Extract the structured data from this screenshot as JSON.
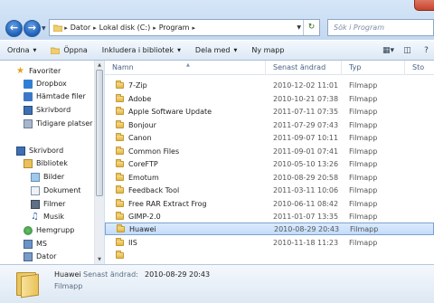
{
  "address": {
    "crumbs": [
      "Dator",
      "Lokal disk (C:)",
      "Program"
    ],
    "search_placeholder": "Sök i Program"
  },
  "toolbar": {
    "organize": "Ordna",
    "open": "Öppna",
    "include": "Inkludera i bibliotek",
    "share": "Dela med",
    "new_folder": "Ny mapp"
  },
  "nav": {
    "favorites": "Favoriter",
    "dropbox": "Dropbox",
    "downloads": "Hämtade filer",
    "desktop_fav": "Skrivbord",
    "recent": "Tidigare platser",
    "desktop": "Skrivbord",
    "libraries": "Bibliotek",
    "pictures": "Bilder",
    "documents": "Dokument",
    "videos": "Filmer",
    "music": "Musik",
    "homegroup": "Hemgrupp",
    "ms": "MS",
    "computer": "Dator"
  },
  "columns": {
    "name": "Namn",
    "date": "Senast ändrad",
    "type": "Typ",
    "size": "Sto"
  },
  "files": [
    {
      "name": "7-Zip",
      "date": "2010-12-02 11:01",
      "type": "Filmapp"
    },
    {
      "name": "Adobe",
      "date": "2010-10-21 07:38",
      "type": "Filmapp"
    },
    {
      "name": "Apple Software Update",
      "date": "2011-07-11 07:35",
      "type": "Filmapp"
    },
    {
      "name": "Bonjour",
      "date": "2011-07-29 07:43",
      "type": "Filmapp"
    },
    {
      "name": "Canon",
      "date": "2011-09-07 10:11",
      "type": "Filmapp"
    },
    {
      "name": "Common Files",
      "date": "2011-09-01 07:41",
      "type": "Filmapp"
    },
    {
      "name": "CoreFTP",
      "date": "2010-05-10 13:26",
      "type": "Filmapp"
    },
    {
      "name": "Emotum",
      "date": "2010-08-29 20:58",
      "type": "Filmapp"
    },
    {
      "name": "Feedback Tool",
      "date": "2011-03-11 10:06",
      "type": "Filmapp"
    },
    {
      "name": "Free RAR Extract Frog",
      "date": "2010-06-11 08:42",
      "type": "Filmapp"
    },
    {
      "name": "GIMP-2.0",
      "date": "2011-01-07 13:35",
      "type": "Filmapp"
    },
    {
      "name": "Huawei",
      "date": "2010-08-29 20:43",
      "type": "Filmapp"
    },
    {
      "name": "IIS",
      "date": "2010-11-18 11:23",
      "type": "Filmapp"
    },
    {
      "name": "",
      "date": "",
      "type": ""
    }
  ],
  "details": {
    "name": "Huawei",
    "modified_label": "Senast ändrad:",
    "modified_value": "2010-08-29 20:43",
    "type": "Filmapp"
  },
  "icons": {
    "back": "back-arrow-icon",
    "forward": "forward-arrow-icon",
    "folder": "folder-icon",
    "refresh": "refresh-icon",
    "search": "search-icon"
  },
  "colors": {
    "selection": "#c2dcfd",
    "header_text": "#4a6382",
    "accent": "#1c5fb6"
  }
}
